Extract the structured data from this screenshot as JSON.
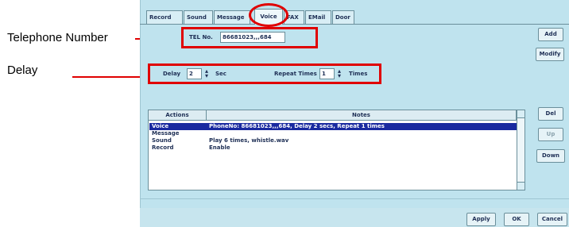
{
  "callouts": {
    "telephone_number": "Telephone Number",
    "delay": "Delay",
    "line_color": "#e00000"
  },
  "tabs": [
    {
      "label": "Record"
    },
    {
      "label": "Sound"
    },
    {
      "label": "Message"
    },
    {
      "label": "Voice"
    },
    {
      "label": "FAX"
    },
    {
      "label": "EMail"
    },
    {
      "label": "Door"
    }
  ],
  "active_tab": "Voice",
  "tel": {
    "label": "TEL No.",
    "value": "86681023,,,684"
  },
  "delay": {
    "label": "Delay",
    "value": "2",
    "unit": "Sec"
  },
  "repeat": {
    "label": "Repeat Times",
    "value": "1",
    "unit": "Times"
  },
  "buttons": {
    "add": "Add",
    "modify": "Modify",
    "del": "Del",
    "up": "Up",
    "down": "Down",
    "apply": "Apply",
    "ok": "OK",
    "cancel": "Cancel"
  },
  "table": {
    "headers": [
      "Actions",
      "Notes"
    ],
    "rows": [
      {
        "action": "Voice",
        "note": "PhoneNo: 86681023,,,684, Delay 2 secs, Repeat 1 times",
        "selected": true
      },
      {
        "action": "Message",
        "note": ""
      },
      {
        "action": "Sound",
        "note": "Play 6 times, whistle.wav"
      },
      {
        "action": "Record",
        "note": "Enable"
      }
    ]
  },
  "colors": {
    "dialog_bg": "#bfe3ee",
    "selection": "#1a2aa0",
    "highlight": "#e00000"
  }
}
